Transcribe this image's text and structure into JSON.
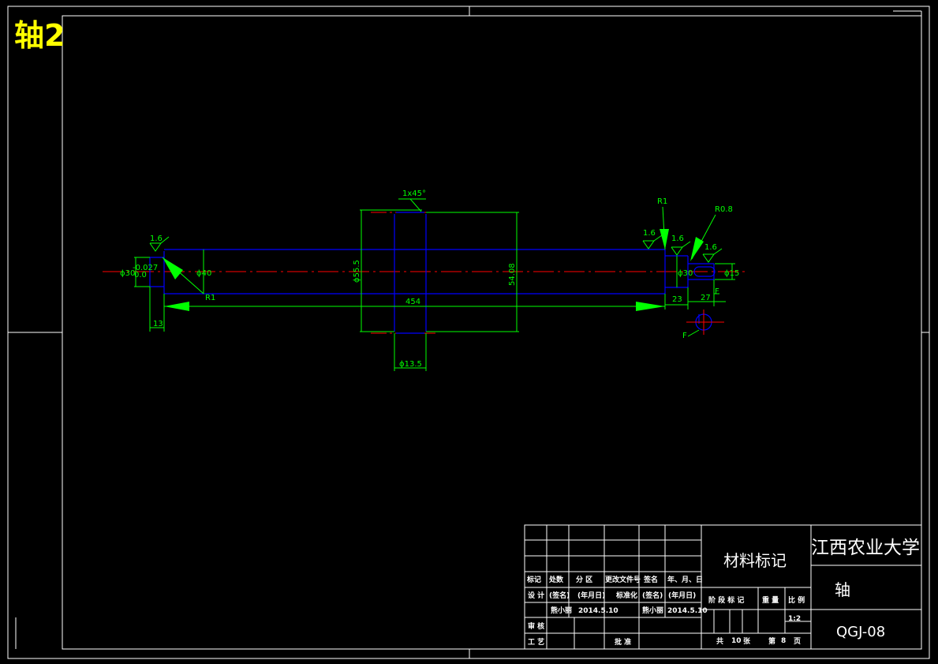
{
  "title": "轴2",
  "dimensions": {
    "chamfer": "1x45°",
    "radius_r1_left": "R1",
    "radius_r1_right": "R1",
    "radius_r08": "R0.8",
    "rough_1": "1.6",
    "rough_2": "1.6",
    "rough_3": "1.6",
    "rough_4": "1.6",
    "dia_30": "ϕ30",
    "tol_upper": "-0.027",
    "tol_lower": "0.0",
    "dia_40": "ϕ40",
    "dia_555": "ϕ55.5",
    "dia_5408": "54.08",
    "dia_30_right": "ϕ30",
    "dia_15": "ϕ15",
    "len_454": "454",
    "len_13": "13",
    "len_23": "23",
    "len_27": "27",
    "dia_135": "ϕ13.5",
    "section_f1": "F",
    "section_f2": "F"
  },
  "title_block": {
    "school": "江西农业大学",
    "material": "材料标记",
    "part_name": "轴",
    "drawing_no": "QGJ-08",
    "row_labels": [
      "标记",
      "处数",
      "分 区",
      "更改文件号",
      "签名",
      "年、月、日"
    ],
    "design": "设 计",
    "sign1": "(签名)",
    "date1": "(年月日)",
    "standard": "标准化",
    "sign2": "(签名)",
    "date2": "(年月日)",
    "designer": "熊小丽",
    "design_date": "2014.5.10",
    "designer2": "熊小丽",
    "design_date2": "2014.5.10",
    "review": "审 核",
    "process": "工 艺",
    "approve": "批 准",
    "stage_label": "阶 段 标 记",
    "weight": "重 量",
    "scale_label": "比 例",
    "scale": "1:2",
    "total_prefix": "共",
    "total": "10",
    "total_suffix": "张",
    "sheet_prefix": "第",
    "sheet": "8",
    "sheet_suffix": "页"
  },
  "colors": {
    "background": "#000000",
    "frame": "#ffffff",
    "outline": "#0000ff",
    "dimension": "#00ff00",
    "centerline": "#ff0000",
    "title": "#ffff00"
  }
}
